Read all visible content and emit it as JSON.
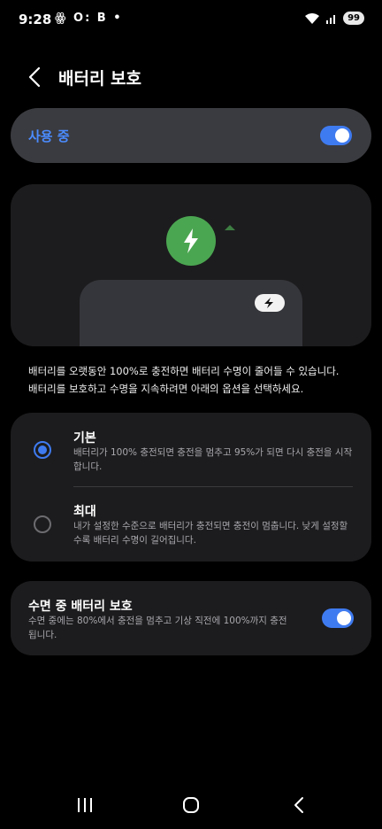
{
  "status_bar": {
    "time": "9:28",
    "left_icons": "ꙮ O: B •",
    "battery": "99"
  },
  "header": {
    "title": "배터리 보호"
  },
  "master": {
    "label": "사용 중",
    "enabled": true
  },
  "description": {
    "line1": "배터리를 오랫동안 100%로 충전하면 배터리 수명이 줄어들 수 있습니다.",
    "line2": "배터리를 보호하고 수명을 지속하려면 아래의 옵션을 선택하세요."
  },
  "options": [
    {
      "title": "기본",
      "desc": "배터리가 100% 충전되면 충전을 멈추고 95%가 되면 다시 충전을 시작합니다.",
      "selected": true
    },
    {
      "title": "최대",
      "desc": "내가 설정한 수준으로 배터리가 충전되면 충전이 멈춥니다. 낮게 설정할수록 배터리 수명이 길어집니다.",
      "selected": false
    }
  ],
  "sleep": {
    "title": "수면 중 배터리 보호",
    "desc": "수면 중에는 80%에서 충전을 멈추고 기상 직전에 100%까지 충전됩니다.",
    "enabled": true
  },
  "colors": {
    "accent": "#3f7bf0",
    "charge_green": "#4ba651",
    "card": "#1c1c1e"
  }
}
